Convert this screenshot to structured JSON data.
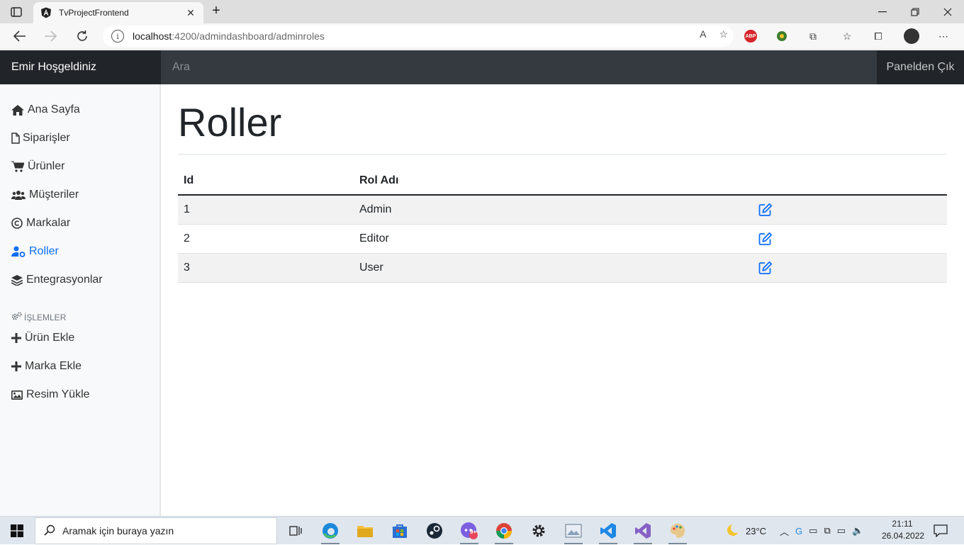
{
  "browser": {
    "tab_title": "TvProjectFrontend",
    "tab_close": "✕",
    "new_tab": "+",
    "url_host": "localhost",
    "url_path": ":4200/admindashboard/adminroles",
    "read_aloud": "A",
    "abp_label": "ABP"
  },
  "app": {
    "brand": "Emir Hoşgeldiniz",
    "search_placeholder": "Ara",
    "signout": "Panelden Çık"
  },
  "sidebar": {
    "items": [
      {
        "label": "Ana Sayfa",
        "icon": "home-icon"
      },
      {
        "label": "Siparişler",
        "icon": "file-icon"
      },
      {
        "label": "Ürünler",
        "icon": "cart-icon"
      },
      {
        "label": "Müşteriler",
        "icon": "users-icon"
      },
      {
        "label": "Markalar",
        "icon": "copyright-icon"
      },
      {
        "label": "Roller",
        "icon": "user-cog-icon",
        "active": true
      },
      {
        "label": "Entegrasyonlar",
        "icon": "layers-icon"
      }
    ],
    "section_heading": "İŞLEMLER",
    "actions": [
      {
        "label": "Ürün Ekle",
        "icon": "plus-icon"
      },
      {
        "label": "Marka Ekle",
        "icon": "plus-icon"
      },
      {
        "label": "Resim Yükle",
        "icon": "image-icon"
      }
    ]
  },
  "main": {
    "title": "Roller",
    "table": {
      "headers": {
        "id": "Id",
        "name": "Rol Adı"
      },
      "rows": [
        {
          "id": "1",
          "name": "Admin"
        },
        {
          "id": "2",
          "name": "Editor"
        },
        {
          "id": "3",
          "name": "User"
        }
      ]
    }
  },
  "taskbar": {
    "search_placeholder": "Aramak için buraya yazın",
    "weather": "23°C",
    "time": "21:11",
    "date": "26.04.2022",
    "badge": "9+"
  },
  "colors": {
    "accent": "#0d6efd",
    "navbar": "#343a40",
    "navbar_dark": "#212529",
    "sidebar_bg": "#f8f9fa"
  }
}
